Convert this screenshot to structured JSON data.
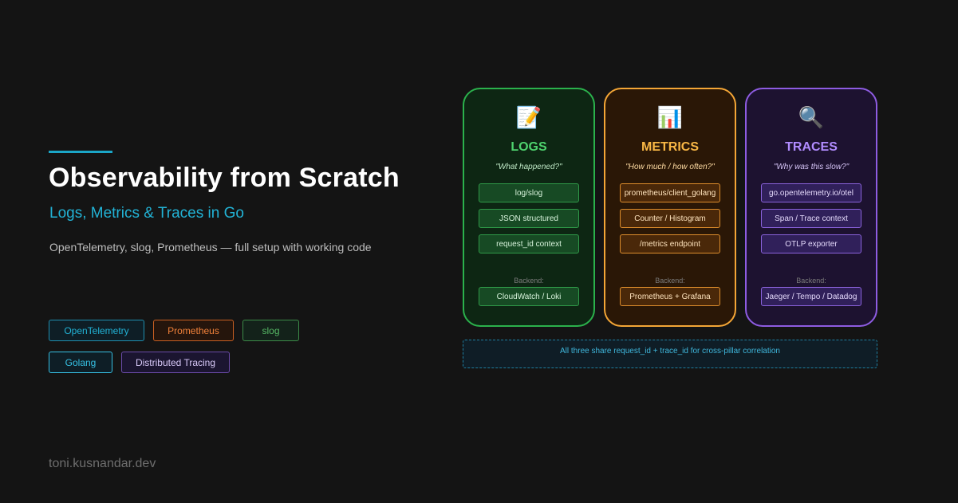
{
  "hero": {
    "title": "Observability from Scratch",
    "subtitle": "Logs, Metrics & Traces in Go",
    "description": "OpenTelemetry, slog, Prometheus — full setup with working code",
    "accent_color": "#1ba6c7"
  },
  "tags": [
    {
      "label": "OpenTelemetry",
      "color": "#22b3d6"
    },
    {
      "label": "Prometheus",
      "color": "#f0813a"
    },
    {
      "label": "slog",
      "color": "#4caf50"
    },
    {
      "label": "Golang",
      "color": "#22b3d6"
    },
    {
      "label": "Distributed Tracing",
      "color": "#8e5ce2"
    }
  ],
  "pillars": [
    {
      "icon": "memo-icon",
      "emoji": "📝",
      "title": "LOGS",
      "tagline": "\"What happened?\"",
      "items": [
        "log/slog",
        "JSON structured",
        "request_id context"
      ],
      "backend_label": "Backend:",
      "backend": "CloudWatch / Loki",
      "color": "#2bb14c"
    },
    {
      "icon": "bar-chart-icon",
      "emoji": "📊",
      "title": "METRICS",
      "tagline": "\"How much / how often?\"",
      "items": [
        "prometheus/client_golang",
        "Counter / Histogram",
        "/metrics endpoint"
      ],
      "backend_label": "Backend:",
      "backend": "Prometheus + Grafana",
      "color": "#f4a636"
    },
    {
      "icon": "magnifier-icon",
      "emoji": "🔍",
      "title": "TRACES",
      "tagline": "\"Why was this slow?\"",
      "items": [
        "go.opentelemetry.io/otel",
        "Span / Trace context",
        "OTLP exporter"
      ],
      "backend_label": "Backend:",
      "backend": "Jaeger / Tempo / Datadog",
      "color": "#8e5ce2"
    }
  ],
  "correlation_note": "All three share request_id + trace_id for cross-pillar correlation",
  "footer": {
    "domain": "toni.kusnandar.dev"
  }
}
